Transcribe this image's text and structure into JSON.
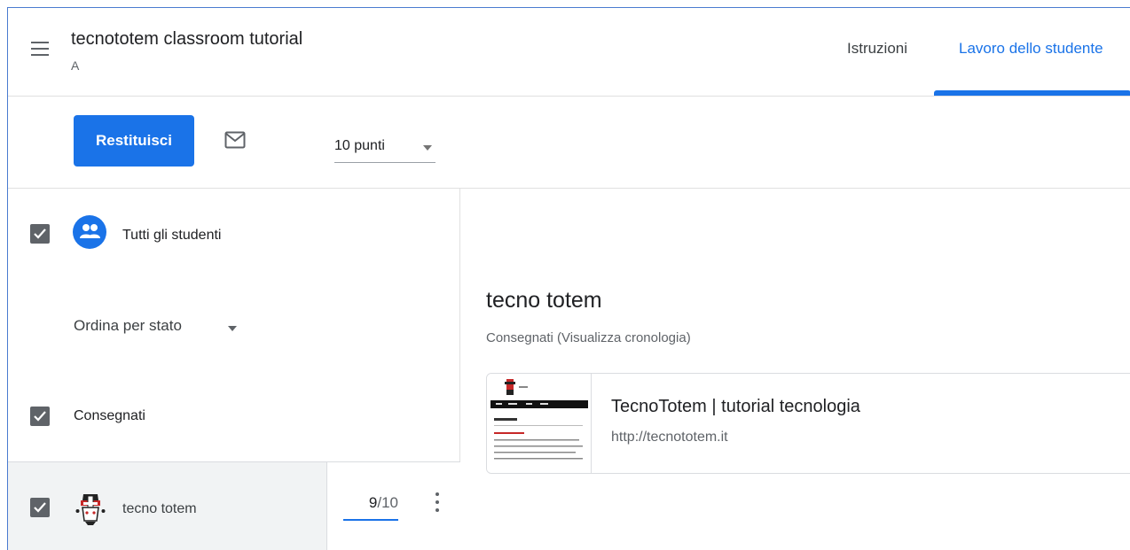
{
  "header": {
    "title": "tecnototem classroom tutorial",
    "subtitle": "A",
    "tabs": [
      {
        "label": "Istruzioni",
        "active": false
      },
      {
        "label": "Lavoro dello studente",
        "active": true
      }
    ]
  },
  "toolbar": {
    "return_label": "Restituisci",
    "points_value": "10 punti"
  },
  "left_panel": {
    "all_students_label": "Tutti gli studenti",
    "sort_label": "Ordina per stato",
    "section_label": "Consegnati",
    "students": [
      {
        "name": "tecno totem",
        "grade": "9",
        "max": "/10"
      }
    ]
  },
  "right_panel": {
    "student_name": "tecno totem",
    "status": "Consegnati (Visualizza cronologia)",
    "attachment": {
      "title": "TecnoTotem | tutorial tecnologia",
      "url": "http://tecnototem.it"
    }
  },
  "colors": {
    "accent": "#1a73e8",
    "checkbox": "#5f6368",
    "selected_row": "#f1f3f4"
  }
}
